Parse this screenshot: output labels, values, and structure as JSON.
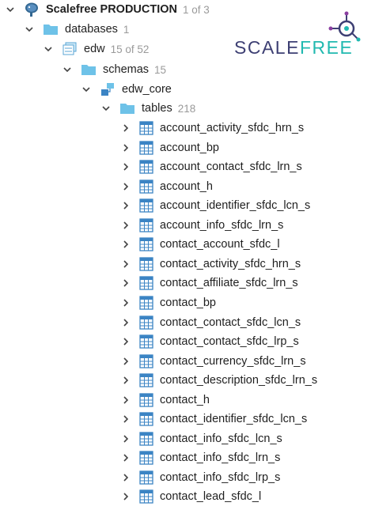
{
  "connection": {
    "name": "Scalefree PRODUCTION",
    "count": "1 of 3"
  },
  "databases": {
    "label": "databases",
    "count": "1"
  },
  "database": {
    "name": "edw",
    "count": "15 of 52"
  },
  "schemas": {
    "label": "schemas",
    "count": "15"
  },
  "schema": {
    "name": "edw_core"
  },
  "tables": {
    "label": "tables",
    "count": "218",
    "items": [
      "account_activity_sfdc_hrn_s",
      "account_bp",
      "account_contact_sfdc_lrn_s",
      "account_h",
      "account_identifier_sfdc_lcn_s",
      "account_info_sfdc_lrn_s",
      "contact_account_sfdc_l",
      "contact_activity_sfdc_hrn_s",
      "contact_affiliate_sfdc_lrn_s",
      "contact_bp",
      "contact_contact_sfdc_lcn_s",
      "contact_contact_sfdc_lrp_s",
      "contact_currency_sfdc_lrn_s",
      "contact_description_sfdc_lrn_s",
      "contact_h",
      "contact_identifier_sfdc_lcn_s",
      "contact_info_sfdc_lcn_s",
      "contact_info_sfdc_lrn_s",
      "contact_info_sfdc_lrp_s",
      "contact_lead_sfdc_l"
    ]
  },
  "logo": {
    "text_main": "SCALE",
    "text_accent": "FREE"
  },
  "colors": {
    "folder": "#6ec2e8",
    "table_icon": "#3b84c4",
    "count_text": "#9a9a9a",
    "logo_navy": "#3d3f73",
    "logo_teal": "#21b9b0",
    "logo_purple": "#8a3ea0"
  },
  "icons": {
    "connection": "postgres-elephant-icon",
    "folder": "folder-icon",
    "database": "database-stack-icon",
    "schema": "schema-icon",
    "table": "table-grid-icon",
    "expand": "chevron-right-icon",
    "collapse": "chevron-down-icon"
  }
}
